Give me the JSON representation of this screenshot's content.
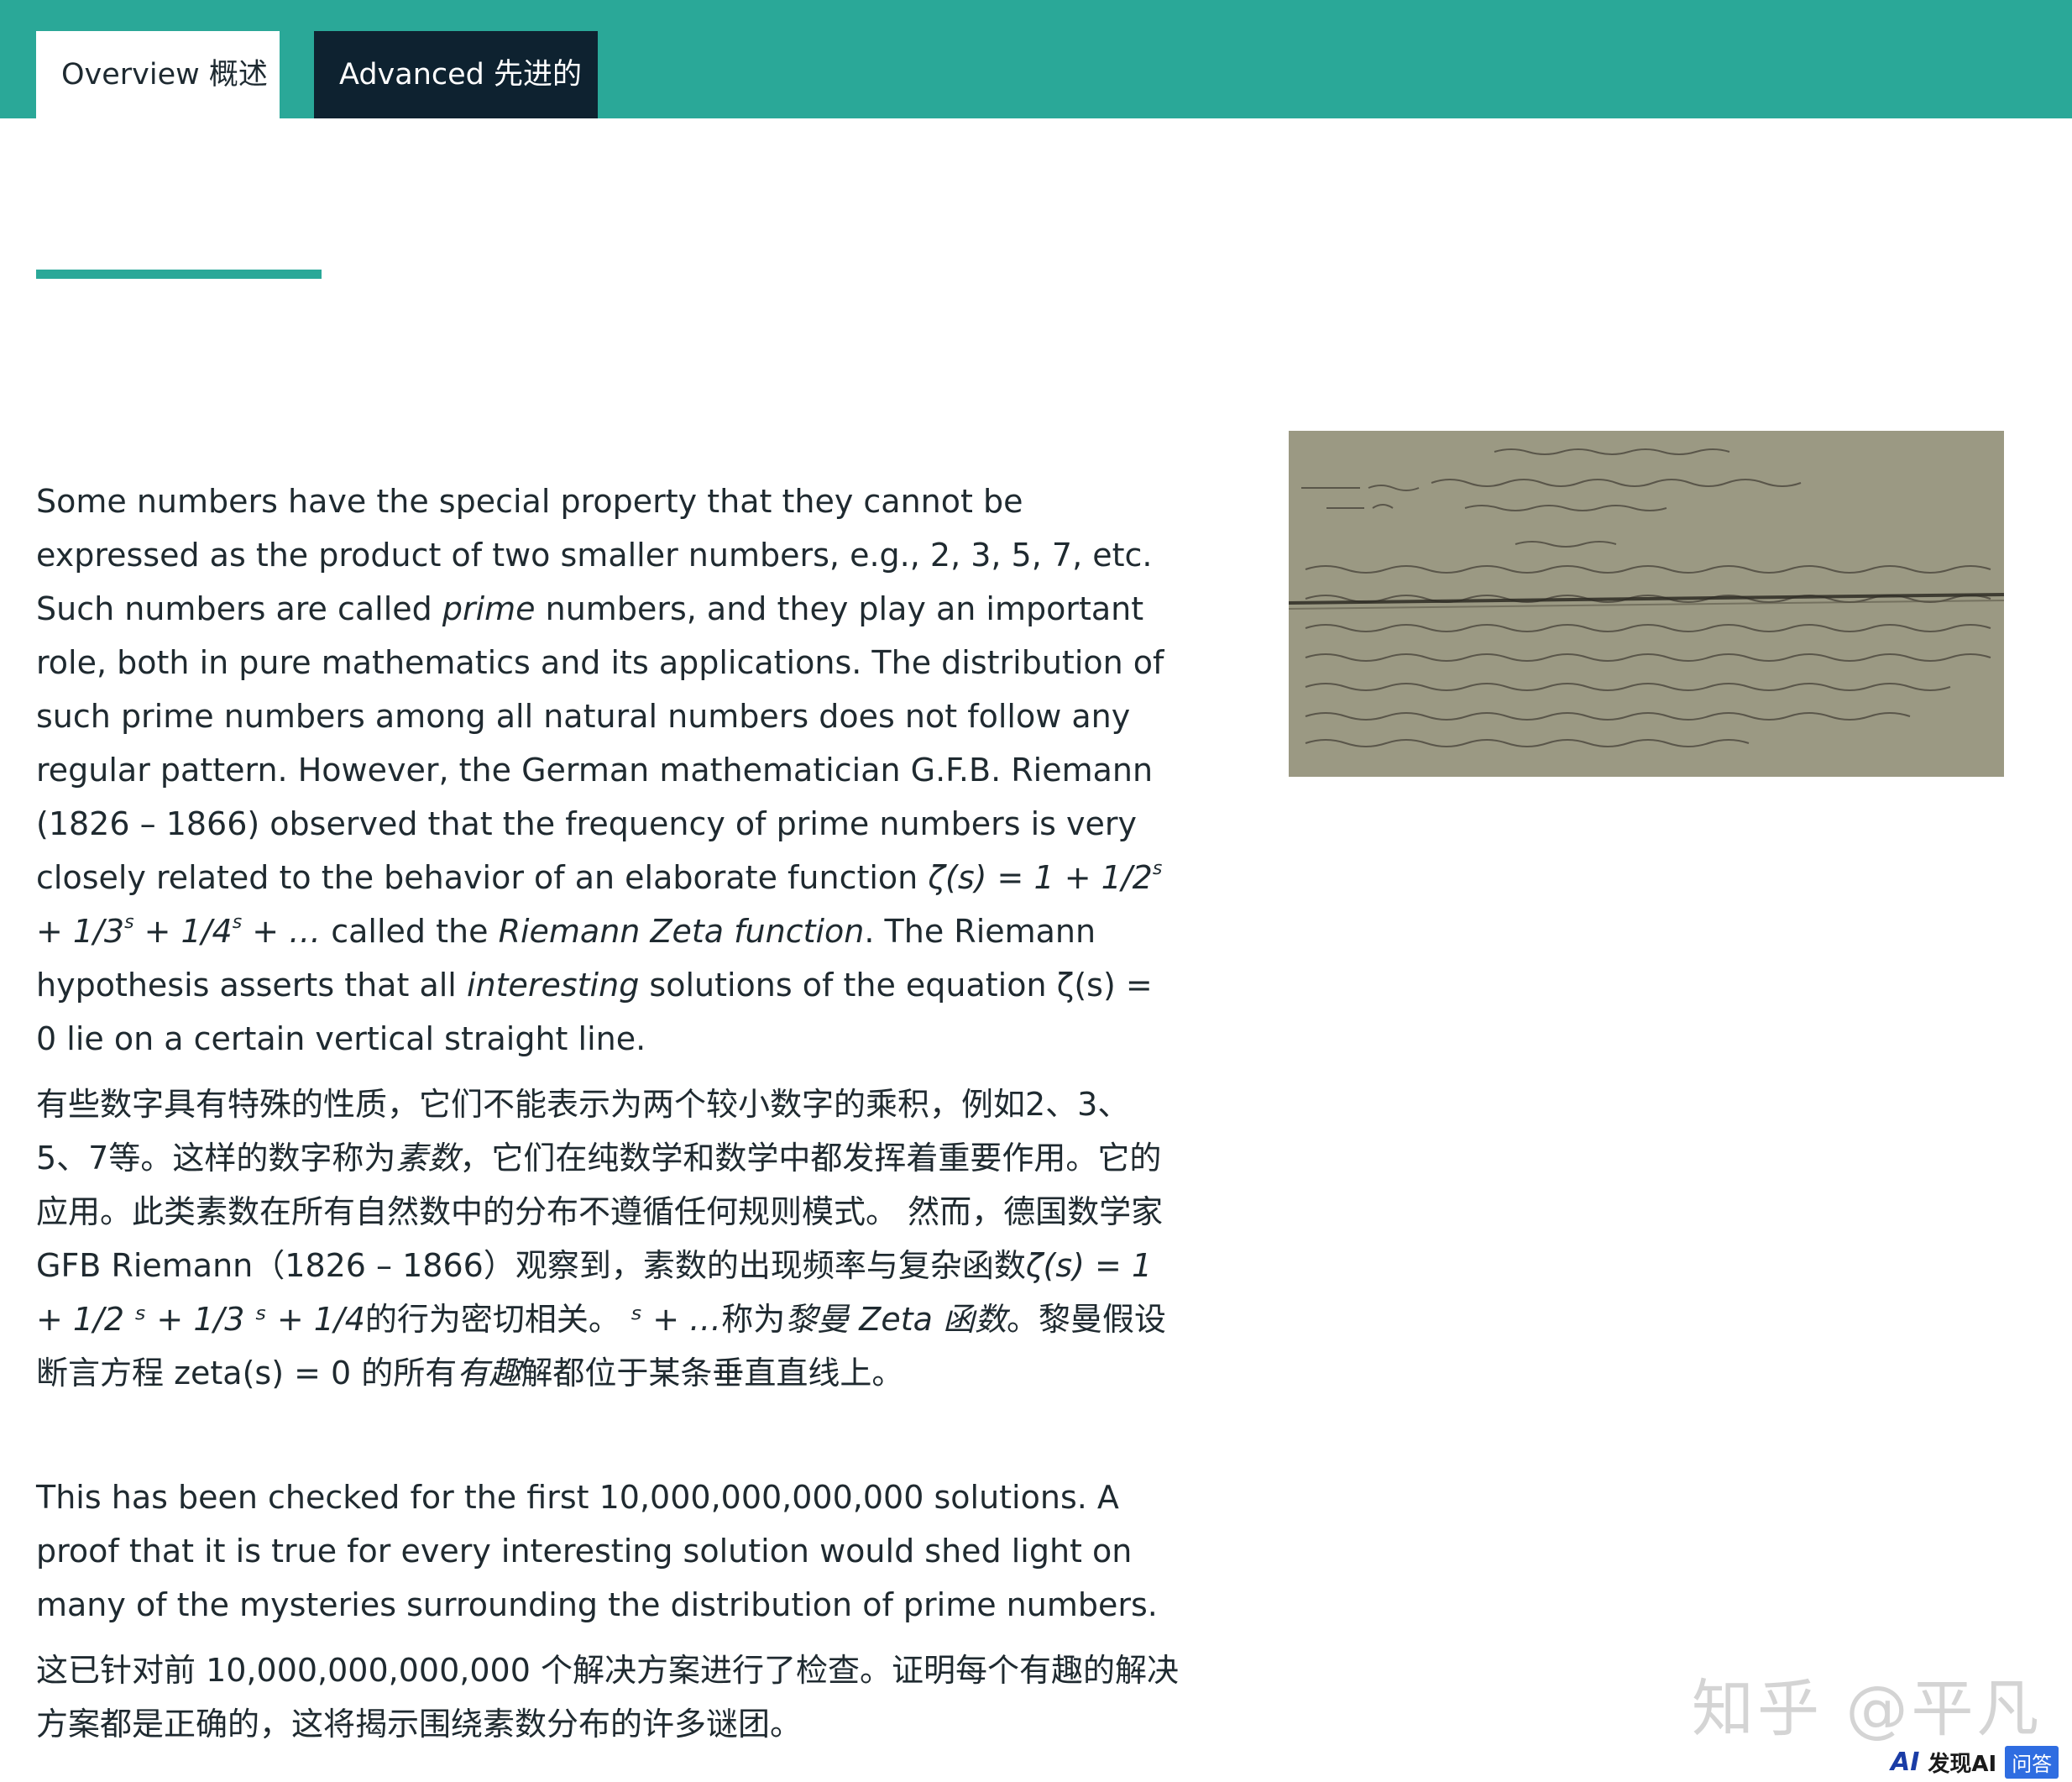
{
  "tabs": [
    {
      "label": "Overview 概述",
      "active": true
    },
    {
      "label": "Advanced 先进的",
      "active": false
    }
  ],
  "paragraph1": {
    "a": "Some numbers have the special property that they cannot be expressed as the product of two smaller numbers, e.g., 2, 3, 5, 7, etc. Such numbers are called ",
    "prime": "prime",
    "b": " numbers, and they play an important role, both in pure mathematics and its applications. The distribution of such prime numbers among all natural numbers does not follow any regular pattern.  However, the German mathematician G.F.B. Riemann (1826 – 1866) observed that the frequency of prime numbers is very closely related to the behavior of an elaborate function ",
    "f_lhs": "ζ(s) = 1 + 1/2",
    "f_p2": " + 1/3",
    "f_p3": " + 1/4",
    "f_end": " + … ",
    "s": "s",
    "c": " called the ",
    "zeta_name": "Riemann Zeta function",
    "d": ". The Riemann hypothesis asserts that all ",
    "interesting": "interesting",
    "e": " solutions of the equation ζ(s) = 0 lie on a certain vertical straight line."
  },
  "paragraph1_zh": {
    "a": "有些数字具有特殊的性质，它们不能表示为两个较小数字的乘积，例如2、3、5、7等。这样的数字称为",
    "sushu": "素数",
    "b": "，它们在纯数学和数学中都发挥着重要作用。它的应用。此类素数在所有自然数中的分布不遵循任何规则模式。 然而，德国数学家 GFB Riemann（1826 – 1866）观察到，素数的出现频率与复杂函数",
    "formula": "ζ(s) = 1 + 1/2 ˢ + 1/3 ˢ + 1/4",
    "c": "的行为密切相关。",
    "formula2": " ˢ + …",
    "d": "称为",
    "zeta_name": "黎曼 Zeta 函数",
    "e": "。黎曼假设断言方程 zeta(s) = 0 的所有",
    "youqu": "有趣",
    "f": "解都位于某条垂直直线上。"
  },
  "paragraph2": "This has been checked for the first 10,000,000,000,000 solutions. A proof that it is true for every interesting solution would shed light on many of the mysteries surrounding the distribution of prime numbers.",
  "paragraph2_zh": "这已针对前 10,000,000,000,000 个解决方案进行了检查。证明每个有趣的解决方案都是正确的，这将揭示围绕素数分布的许多谜团。",
  "watermark": "知乎 @平凡",
  "footer": {
    "ai": "AI",
    "brand": "发现AI",
    "badge": "问答"
  },
  "colors": {
    "accent": "#2aa898",
    "dark_tab": "#0e2230",
    "text": "#1f2a30"
  }
}
